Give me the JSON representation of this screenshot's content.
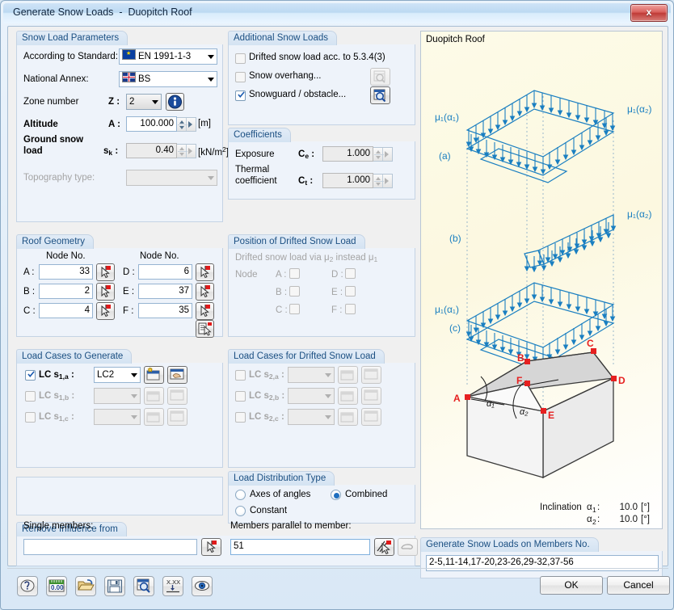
{
  "window": {
    "title": "Generate Snow Loads  -  Duopitch Roof",
    "close_label": "x"
  },
  "snow_load_parameters": {
    "title": "Snow Load Parameters",
    "standard_label": "According to Standard:",
    "standard_value": "EN 1991-1-3",
    "annex_label": "National Annex:",
    "annex_value": "BS",
    "zone_label": "Zone number",
    "zone_symbol": "Z :",
    "zone_value": "2",
    "info_icon": "i",
    "altitude_label": "Altitude",
    "altitude_symbol": "A :",
    "altitude_value": "100.000",
    "altitude_unit": "[m]",
    "ground_snow_label_1": "Ground snow",
    "ground_snow_label_2": "load",
    "ground_snow_symbol": "s",
    "ground_snow_symbol_sub": "k",
    "ground_snow_colon": ":",
    "ground_snow_value": "0.40",
    "ground_snow_unit": "[kN/m",
    "ground_snow_unit_sup": "2",
    "ground_snow_unit_end": "]",
    "topography_label": "Topography type:",
    "topography_value": ""
  },
  "roof_geometry": {
    "title": "Roof Geometry",
    "node_header_left": "Node No.",
    "node_header_right": "Node No.",
    "rows": [
      {
        "left_label": "A :",
        "left_value": "33",
        "right_label": "D :",
        "right_value": "6"
      },
      {
        "left_label": "B :",
        "left_value": "2",
        "right_label": "E :",
        "right_value": "37"
      },
      {
        "left_label": "C :",
        "left_value": "4",
        "right_label": "F :",
        "right_value": "35"
      }
    ]
  },
  "load_cases_to_generate": {
    "title": "Load Cases to Generate",
    "rows": [
      {
        "label_main": "LC s",
        "label_sub": "1,a",
        "label_colon": ":",
        "checked": true,
        "value": "LC2",
        "enabled": true
      },
      {
        "label_main": "LC s",
        "label_sub": "1,b",
        "label_colon": ":",
        "checked": false,
        "value": "",
        "enabled": false
      },
      {
        "label_main": "LC s",
        "label_sub": "1,c",
        "label_colon": ":",
        "checked": false,
        "value": "",
        "enabled": false
      }
    ]
  },
  "additional_snow_loads": {
    "title": "Additional Snow Loads",
    "rows": [
      {
        "label": "Drifted snow load acc. to 5.3.4(3)",
        "checked": false,
        "has_button": false
      },
      {
        "label": "Snow overhang...",
        "checked": false,
        "has_button": true,
        "button_enabled": false
      },
      {
        "label": "Snowguard / obstacle...",
        "checked": true,
        "has_button": true,
        "button_enabled": true
      }
    ]
  },
  "coefficients": {
    "title": "Coefficients",
    "exposure_label": "Exposure",
    "exposure_symbol": "C",
    "exposure_symbol_sub": "e",
    "exposure_value": "1.000",
    "thermal_label_1": "Thermal",
    "thermal_label_2": "coefficient",
    "thermal_symbol": "C",
    "thermal_symbol_sub": "t",
    "thermal_value": "1.000"
  },
  "position_of_drifted_snow_load": {
    "title": "Position of Drifted Snow Load",
    "subtitle_a": "Drifted snow load via ",
    "subtitle_mu2": "μ",
    "subtitle_mu2_sub": "2",
    "subtitle_b": " instead ",
    "subtitle_mu1": "μ",
    "subtitle_mu1_sub": "1",
    "node_label": "Node",
    "left_items": [
      "A :",
      "B :",
      "C :"
    ],
    "right_items": [
      "D :",
      "E :",
      "F :"
    ]
  },
  "load_cases_for_drifted_snow_load": {
    "title": "Load Cases for Drifted Snow Load",
    "rows": [
      {
        "label_main": "LC s",
        "label_sub": "2,a",
        "label_colon": ":",
        "checked": false,
        "value": ""
      },
      {
        "label_main": "LC s",
        "label_sub": "2,b",
        "label_colon": ":",
        "checked": false,
        "value": ""
      },
      {
        "label_main": "LC s",
        "label_sub": "2,c",
        "label_colon": ":",
        "checked": false,
        "value": ""
      }
    ]
  },
  "load_distribution_type": {
    "title": "Load Distribution Type",
    "options": [
      {
        "label": "Axes of angles",
        "selected": false
      },
      {
        "label": "Constant",
        "selected": false
      },
      {
        "label": "Combined",
        "selected": true
      }
    ]
  },
  "remove_influence_from": {
    "title": "Remove Influence from",
    "single_members_label": "Single members:",
    "single_members_value": "",
    "parallel_label": "Members parallel to member:",
    "parallel_value": "51"
  },
  "diagram": {
    "title": "Duopitch Roof",
    "labels": {
      "a": "(a)",
      "b": "(b)",
      "c": "(c)",
      "mu1_a1": "μ₁(α₁)",
      "mu1_a2": "μ₁(α₂)",
      "nodes": [
        "A",
        "B",
        "C",
        "D",
        "E",
        "F"
      ],
      "alpha1": "α₁",
      "alpha2": "α₂"
    },
    "inclination_label": "Inclination",
    "inclination_rows": [
      {
        "symbol": "α",
        "sub": "1",
        "colon": ":",
        "value": "10.0",
        "unit": "[°]"
      },
      {
        "symbol": "α",
        "sub": "2",
        "colon": ":",
        "value": "10.0",
        "unit": "[°]"
      }
    ]
  },
  "generate_on_members": {
    "title": "Generate Snow Loads on Members No.",
    "value": "2-5,11-14,17-20,23-26,29-32,37-56"
  },
  "footer": {
    "tools": [
      "help-icon",
      "units-icon",
      "open-icon",
      "save-icon",
      "info-view-icon",
      "decimal-places-icon",
      "view-icon"
    ],
    "ok_label": "OK",
    "cancel_label": "Cancel"
  },
  "colors": {
    "accent": "#1b4f82",
    "diagram_blue": "#1a7fc1",
    "node_red": "#e62020",
    "titlebar": "#bcd9f2"
  }
}
